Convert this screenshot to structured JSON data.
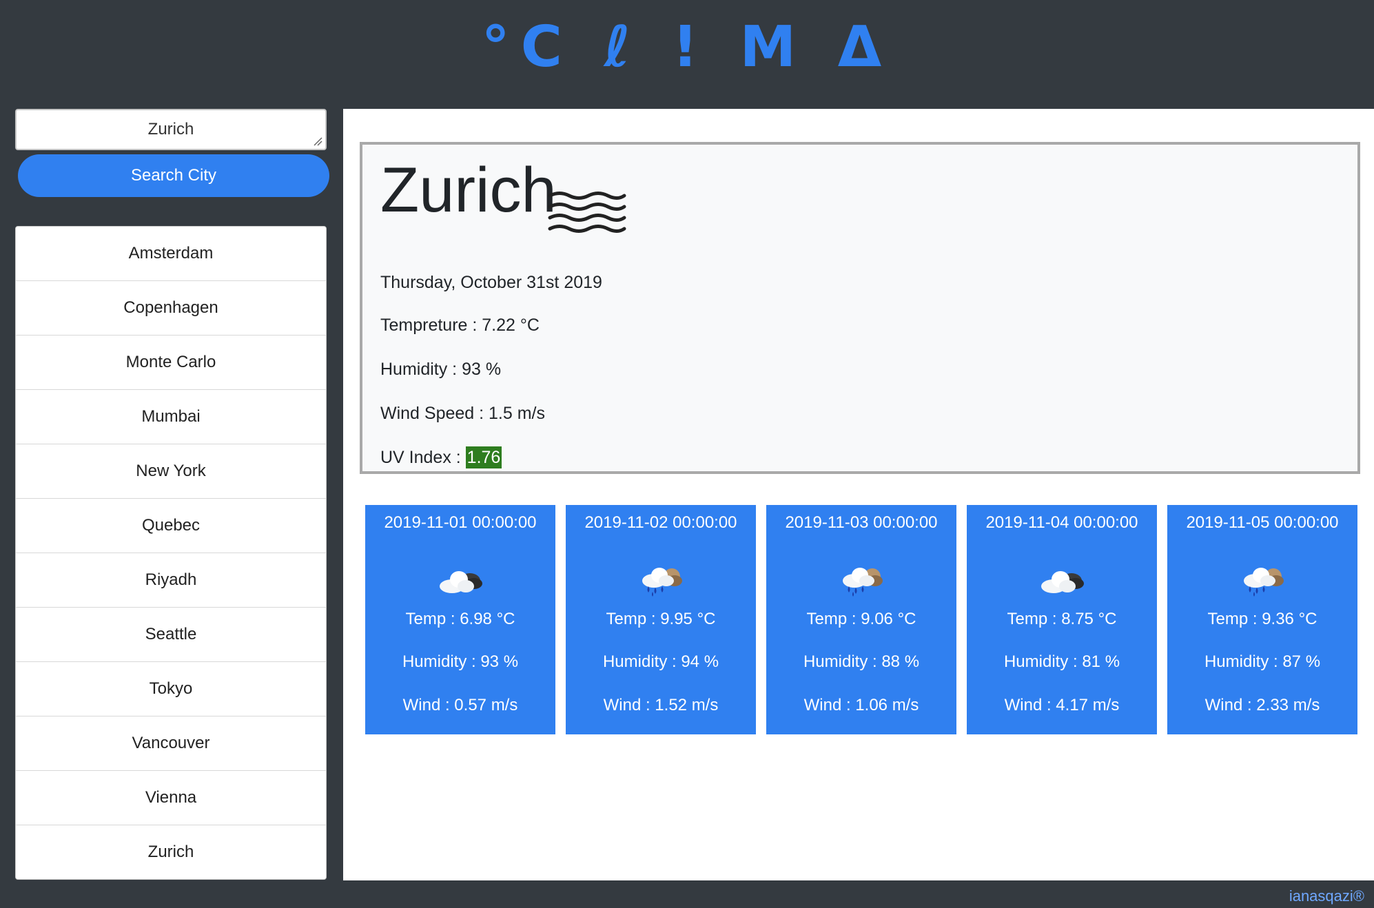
{
  "app": {
    "logo": "°C ℓ ! M Δ"
  },
  "search": {
    "value": "Zurich",
    "button_label": "Search City"
  },
  "cities": [
    "Amsterdam",
    "Copenhagen",
    "Monte Carlo",
    "Mumbai",
    "New York",
    "Quebec",
    "Riyadh",
    "Seattle",
    "Tokyo",
    "Vancouver",
    "Vienna",
    "Zurich"
  ],
  "current": {
    "city": "Zurich",
    "icon": "mist-icon",
    "date": "Thursday, October 31st 2019",
    "temperature": "Tempreture : 7.22 °C",
    "humidity": "Humidity : 93 %",
    "wind": "Wind Speed : 1.5 m/s",
    "uv_label": "UV Index : ",
    "uv_value": "1.76",
    "uv_color": "#2e7d1f"
  },
  "forecast": [
    {
      "date": "2019-11-01 00:00:00",
      "icon": "cloud-icon",
      "temp": "Temp : 6.98 °C",
      "humidity": "Humidity : 93 %",
      "wind": "Wind : 0.57 m/s"
    },
    {
      "date": "2019-11-02 00:00:00",
      "icon": "rain-cloud-icon",
      "temp": "Temp : 9.95 °C",
      "humidity": "Humidity : 94 %",
      "wind": "Wind : 1.52 m/s"
    },
    {
      "date": "2019-11-03 00:00:00",
      "icon": "rain-cloud-icon",
      "temp": "Temp : 9.06 °C",
      "humidity": "Humidity : 88 %",
      "wind": "Wind : 1.06 m/s"
    },
    {
      "date": "2019-11-04 00:00:00",
      "icon": "cloud-icon",
      "temp": "Temp : 8.75 °C",
      "humidity": "Humidity : 81 %",
      "wind": "Wind : 4.17 m/s"
    },
    {
      "date": "2019-11-05 00:00:00",
      "icon": "rain-cloud-icon",
      "temp": "Temp : 9.36 °C",
      "humidity": "Humidity : 87 %",
      "wind": "Wind : 2.33 m/s"
    }
  ],
  "footer": {
    "credit": "ianasqazi®"
  },
  "colors": {
    "accent": "#3080f0",
    "background": "#343a40"
  }
}
